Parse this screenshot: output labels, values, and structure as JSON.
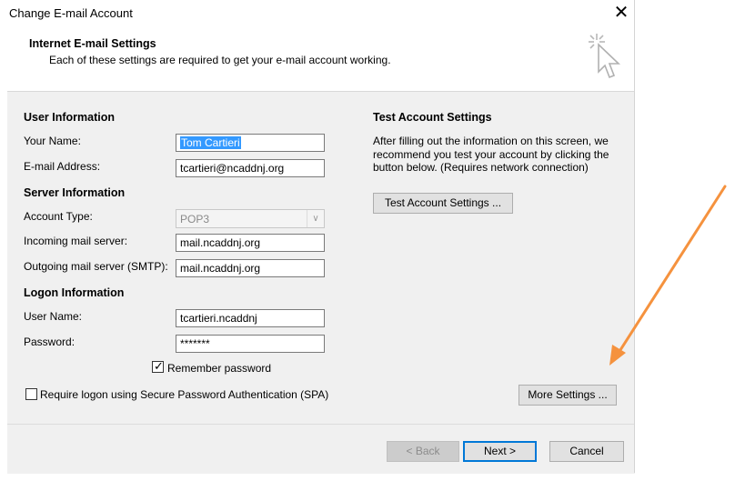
{
  "window": {
    "title": "Change E-mail Account",
    "close_label": "✕"
  },
  "header": {
    "title": "Internet E-mail Settings",
    "subtitle": "Each of these settings are required to get your e-mail account working."
  },
  "user_info": {
    "heading": "User Information",
    "name_label": "Your Name:",
    "name_value": "Tom Cartieri",
    "email_label": "E-mail Address:",
    "email_value": "tcartieri@ncaddnj.org"
  },
  "server_info": {
    "heading": "Server Information",
    "account_type_label": "Account Type:",
    "account_type_value": "POP3",
    "incoming_label": "Incoming mail server:",
    "incoming_value": "mail.ncaddnj.org",
    "outgoing_label": "Outgoing mail server (SMTP):",
    "outgoing_value": "mail.ncaddnj.org"
  },
  "logon_info": {
    "heading": "Logon Information",
    "username_label": "User Name:",
    "username_value": "tcartieri.ncaddnj",
    "password_label": "Password:",
    "password_value": "*******",
    "remember_label": "Remember password",
    "remember_checked": true,
    "spa_label": "Require logon using Secure Password Authentication (SPA)",
    "spa_checked": false
  },
  "test_settings": {
    "heading": "Test Account Settings",
    "description": "After filling out the information on this screen, we recommend you test your account by clicking the button below. (Requires network connection)",
    "button_label": "Test Account Settings ..."
  },
  "more_settings_label": "More Settings ...",
  "footer": {
    "back_label": "< Back",
    "next_label": "Next >",
    "cancel_label": "Cancel"
  },
  "colors": {
    "accent": "#0078d7",
    "selection": "#3399ff",
    "annotation_arrow": "#f5923e",
    "panel_bg": "#f0f0f0"
  }
}
